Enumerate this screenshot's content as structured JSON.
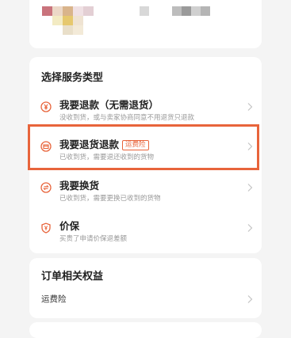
{
  "colors": {
    "accent": "#e8643b",
    "background": "#f4f4f4",
    "card": "#ffffff"
  },
  "service_section": {
    "title": "选择服务类型",
    "options": [
      {
        "icon": "yen-coin-icon",
        "title": "我要退款（无需退货）",
        "subtitle": "没收到货，或与卖家协商同意不用退货只退款"
      },
      {
        "icon": "return-box-icon",
        "title": "我要退货退款",
        "badge": "运费险",
        "subtitle": "已收到货，需要退还收到的货物"
      },
      {
        "icon": "exchange-icon",
        "title": "我要换货",
        "subtitle": "已收到货，需要更换已收到的货物"
      },
      {
        "icon": "price-protect-icon",
        "title": "价保",
        "subtitle": "买贵了申请价保退差额"
      }
    ]
  },
  "benefits_section": {
    "title": "订单相关权益",
    "items": [
      {
        "label": "运费险"
      }
    ]
  }
}
